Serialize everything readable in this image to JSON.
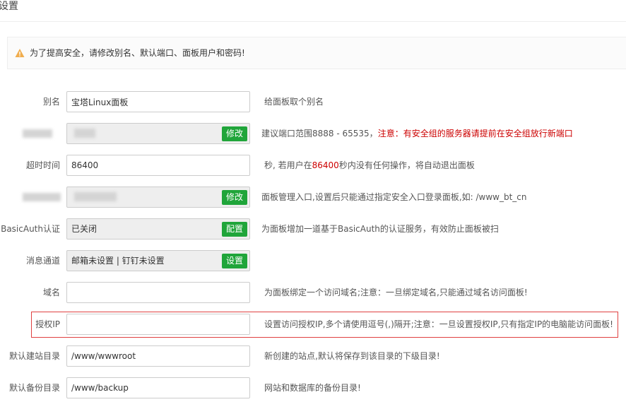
{
  "page": {
    "title": "设置"
  },
  "warning": {
    "icon": "warning-triangle-icon",
    "color": "#f0ad4e",
    "text": "为了提高安全，请修改别名、默认端口、面板用户和密码!"
  },
  "colors": {
    "accent": "#20a53a",
    "danger": "#cc0000"
  },
  "rows": {
    "alias": {
      "label": "别名",
      "value": "宝塔Linux面板",
      "desc": "给面板取个别名"
    },
    "port": {
      "button": "修改",
      "desc": "建议端口范围8888 - 65535，",
      "desc_warn": "注意：有安全组的服务器请提前在安全组放行新端口"
    },
    "timeout": {
      "label": "超时时间",
      "value": "86400",
      "desc_pre": "秒, 若用户在",
      "desc_num": "86400",
      "desc_post": "秒内没有任何操作，将自动退出面板"
    },
    "entry": {
      "button": "修改",
      "desc": "面板管理入口,设置后只能通过指定安全入口登录面板,如: /www_bt_cn"
    },
    "basicauth": {
      "label": "BasicAuth认证",
      "value": "已关闭",
      "button": "配置",
      "desc": "为面板增加一道基于BasicAuth的认证服务，有效防止面板被扫"
    },
    "notify": {
      "label": "消息通道",
      "value": "邮箱未设置 | 钉钉未设置",
      "button": "设置"
    },
    "domain": {
      "label": "域名",
      "value": "",
      "desc": "为面板绑定一个访问域名;注意：一旦绑定域名,只能通过域名访问面板!"
    },
    "authip": {
      "label": "授权IP",
      "value": "",
      "desc": "设置访问授权IP,多个请使用逗号(,)隔开;注意：一旦设置授权IP,只有指定IP的电脑能访问面板!"
    },
    "sitedir": {
      "label": "默认建站目录",
      "value": "/www/wwwroot",
      "desc": "新创建的站点,默认将保存到该目录的下级目录!"
    },
    "backupdir": {
      "label": "默认备份目录",
      "value": "/www/backup",
      "desc": "网站和数据库的备份目录!"
    }
  }
}
